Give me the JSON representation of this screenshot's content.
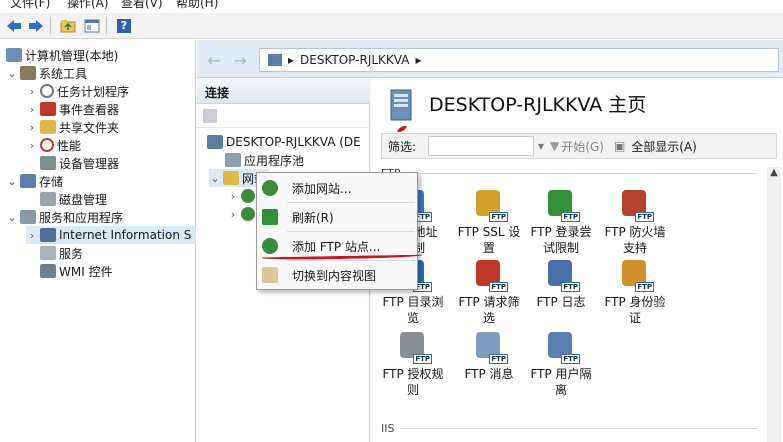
{
  "menu": [
    "文件(F)",
    "操作(A)",
    "查看(V)",
    "帮助(H)"
  ],
  "toolbar": {
    "back_icon": "arrow-left-icon",
    "forward_icon": "arrow-right-icon",
    "up_icon": "folder-up-icon",
    "console_icon": "console-tree-icon",
    "help_label": "?"
  },
  "tree": {
    "root": "计算机管理(本地)",
    "system_tools": "系统工具",
    "task_scheduler": "任务计划程序",
    "event_viewer": "事件查看器",
    "shared_folders": "共享文件夹",
    "performance": "性能",
    "device_manager": "设备管理器",
    "storage": "存储",
    "disk_management": "磁盘管理",
    "services_apps": "服务和应用程序",
    "iis": "Internet Information S",
    "services": "服务",
    "wmi": "WMI 控件"
  },
  "address": {
    "path": "DESKTOP-RJLKKVA"
  },
  "connections": {
    "header": "连接",
    "server": "DESKTOP-RJLKKVA (DE",
    "app_pools": "应用程序池",
    "sites": "网站"
  },
  "main": {
    "title": "DESKTOP-RJLKKVA 主页",
    "filter_label": "筛选:",
    "start_label": "开始(G)",
    "show_all_label": "全部显示(A)",
    "section_ftp": "FTP",
    "section_iis": "IIS",
    "badge": "FTP"
  },
  "features": [
    {
      "label1": "FTP 地址",
      "label2": "限制",
      "icon": "ftp-ip-restriction-icon",
      "color": "#3a79c4"
    },
    {
      "label1": "FTP SSL 设",
      "label2": "置",
      "icon": "ftp-ssl-lock-icon",
      "color": "#d4a12a"
    },
    {
      "label1": "FTP 登录尝",
      "label2": "试限制",
      "icon": "ftp-logon-attempt-icon",
      "color": "#2f8f3a"
    },
    {
      "label1": "FTP 防火墙",
      "label2": "支持",
      "icon": "ftp-firewall-icon",
      "color": "#b4442e"
    },
    {
      "label1": "FTP 目录浏",
      "label2": "览",
      "icon": "ftp-directory-browsing-icon",
      "color": "#2d6fb7"
    },
    {
      "label1": "FTP 请求筛",
      "label2": "选",
      "icon": "ftp-request-filtering-icon",
      "color": "#c0392b"
    },
    {
      "label1": "FTP 日志",
      "label2": "",
      "icon": "ftp-logging-icon",
      "color": "#4a6fa5"
    },
    {
      "label1": "FTP 身份验",
      "label2": "证",
      "icon": "ftp-authentication-icon",
      "color": "#d0902e"
    },
    {
      "label1": "FTP 授权规",
      "label2": "则",
      "icon": "ftp-authorization-icon",
      "color": "#8a8f96"
    },
    {
      "label1": "FTP 消息",
      "label2": "",
      "icon": "ftp-messages-icon",
      "color": "#7c9bbd"
    },
    {
      "label1": "FTP 用户隔",
      "label2": "离",
      "icon": "ftp-user-isolation-icon",
      "color": "#5a7fb0"
    }
  ],
  "context_menu": {
    "add_website": "添加网站...",
    "refresh": "刷新(R)",
    "add_ftp": "添加 FTP 站点...",
    "switch_view": "切换到内容视图"
  },
  "colors": {
    "selection": "#dbe9f7",
    "annotation_red": "#c8141e",
    "address_bar": "#e3ecf6"
  }
}
